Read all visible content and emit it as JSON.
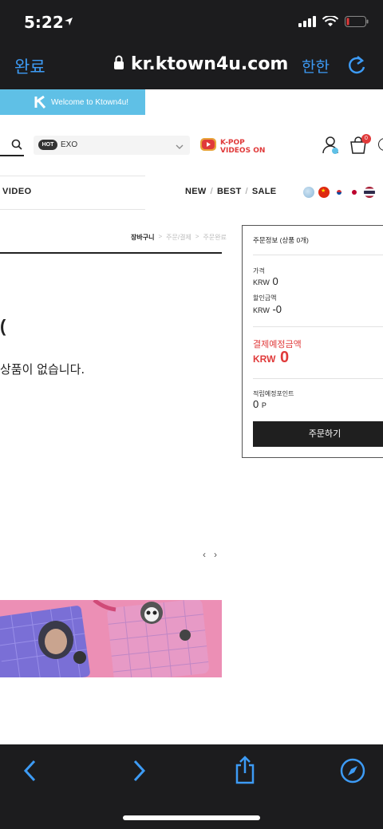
{
  "status_bar": {
    "time": "5:22",
    "battery_color": "#e03a3a"
  },
  "browser": {
    "done_label": "완료",
    "url": "kr.ktown4u.com",
    "translate_label": "한한",
    "accent": "#3d9bf5"
  },
  "header": {
    "welcome_text": "Welcome to Ktown4u!",
    "search": {
      "hot_badge": "HOT",
      "hot_value": "EXO"
    },
    "kpop_logo_line1": "K-POP",
    "kpop_logo_line2": "VIDEOS ON",
    "cart_count": "0"
  },
  "nav": {
    "video_label": "VIDEO",
    "new_label": "NEW",
    "best_label": "BEST",
    "sale_label": "SALE",
    "separator": "/",
    "flags": [
      "globe-icon",
      "china-flag-icon",
      "korea-flag-icon",
      "japan-flag-icon",
      "thailand-flag-icon"
    ]
  },
  "breadcrumb": {
    "current": "장바구니",
    "step2": "주문/결제",
    "step3": "주문완료",
    "separator": ">"
  },
  "cart": {
    "partial_title": "(",
    "empty_message": "상품이 없습니다."
  },
  "carousel": {
    "prev": "‹",
    "next": "›"
  },
  "order_summary": {
    "title": "주문정보 (상품 0개)",
    "price_label": "가격",
    "price_currency": "KRW",
    "price_value": "0",
    "discount_label": "할인금액",
    "discount_currency": "KRW",
    "discount_value": "-0",
    "payment_label": "결제예정금액",
    "payment_currency": "KRW",
    "payment_value": "0",
    "points_label": "적립예정포인트",
    "points_value": "0",
    "points_unit": "P",
    "order_button": "주문하기",
    "accent": "#e03a3a"
  }
}
